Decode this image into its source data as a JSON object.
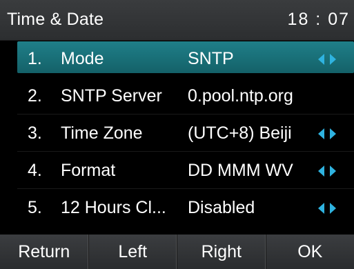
{
  "header": {
    "title": "Time & Date",
    "time": "18 : 07"
  },
  "menu": {
    "items": [
      {
        "number": "1.",
        "label": "Mode",
        "value": "SNTP",
        "selected": true,
        "has_arrows": true
      },
      {
        "number": "2.",
        "label": "SNTP Server",
        "value": "0.pool.ntp.org",
        "selected": false,
        "has_arrows": false
      },
      {
        "number": "3.",
        "label": "Time Zone",
        "value": "(UTC+8) Beiji",
        "selected": false,
        "has_arrows": true
      },
      {
        "number": "4.",
        "label": "Format",
        "value": "DD MMM WV",
        "selected": false,
        "has_arrows": true
      },
      {
        "number": "5.",
        "label": "12 Hours Cl...",
        "value": "Disabled",
        "selected": false,
        "has_arrows": true
      }
    ]
  },
  "softkeys": [
    "Return",
    "Left",
    "Right",
    "OK"
  ],
  "colors": {
    "highlight": "#1a7078",
    "arrow": "#2fb3e0",
    "background": "#000000",
    "bar": "#333537",
    "text": "#ffffff"
  },
  "icons": {
    "arrows": "left-right-arrows-icon"
  }
}
